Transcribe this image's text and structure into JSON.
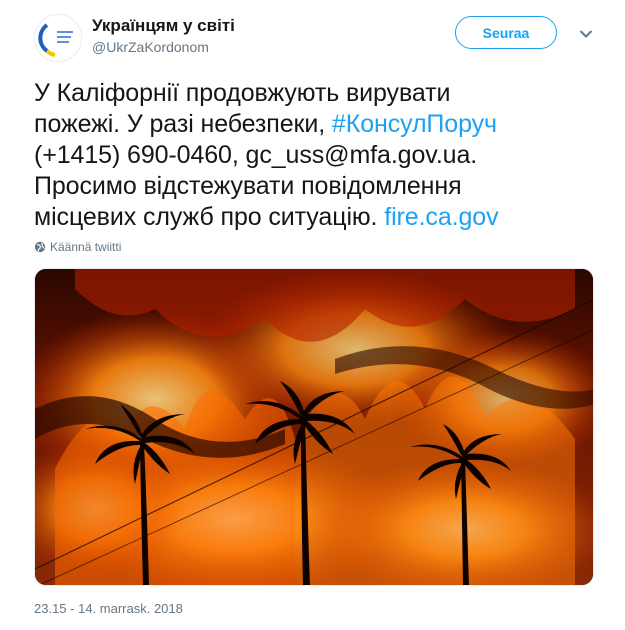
{
  "tweet": {
    "author": {
      "display_name": "Українцям у світі",
      "handle": "@UkrZaKordonom",
      "avatar_icon": "consular-service-logo-icon"
    },
    "follow_label": "Seuraa",
    "menu_icon": "chevron-down-icon",
    "text": {
      "line1": "У Каліфорнії продовжують вирувати",
      "line2_prefix": "пожежі. У разі небезпеки, ",
      "hashtag": "#КонсулПоруч",
      "line3": "(+1415) 690-0460, gc_uss@mfa.gov.ua.",
      "line4": "Просимо відстежувати повідомлення",
      "line5_prefix": "місцевих служб про ситуацію. ",
      "link": "fire.ca.gov"
    },
    "translate_label": "Käännä twiitti",
    "translate_icon": "globe-icon",
    "media_icon": "wildfire-photo",
    "timestamp": "23.15 - 14. marrask. 2018"
  },
  "colors": {
    "accent": "#1da1f2",
    "text": "#14171a",
    "secondary": "#657786"
  }
}
